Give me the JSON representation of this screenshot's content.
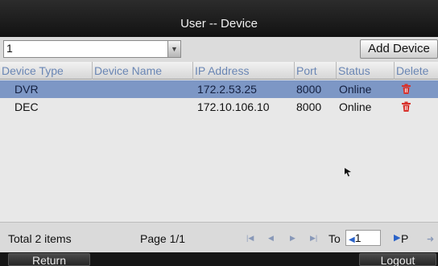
{
  "window": {
    "title": "User -- Device"
  },
  "toolbar": {
    "user_select_value": "1",
    "add_device_label": "Add Device"
  },
  "table": {
    "columns": [
      "Device Type",
      "Device Name",
      "IP Address",
      "Port",
      "Status",
      "Delete"
    ],
    "rows": [
      {
        "device_type": "DVR",
        "device_name": "",
        "ip_address": "172.2.53.25",
        "port": "8000",
        "status": "Online",
        "selected": true
      },
      {
        "device_type": "DEC",
        "device_name": "",
        "ip_address": "172.10.106.10",
        "port": "8000",
        "status": "Online",
        "selected": false
      }
    ]
  },
  "footer": {
    "total": "Total 2 items",
    "page": "Page 1/1",
    "to_label": "To",
    "goto_value": "1",
    "page_suffix": "P"
  },
  "bottom": {
    "return_label": "Return",
    "logout_label": "Logout"
  },
  "icons": {
    "delete": "trash-icon",
    "first": "first-page-icon",
    "prev": "prev-page-icon",
    "next": "next-page-icon",
    "last": "last-page-icon",
    "go": "go-icon"
  },
  "colors": {
    "selected_row": "#7d97c5",
    "header_text": "#6a86b4",
    "delete_icon": "#d8322c"
  }
}
